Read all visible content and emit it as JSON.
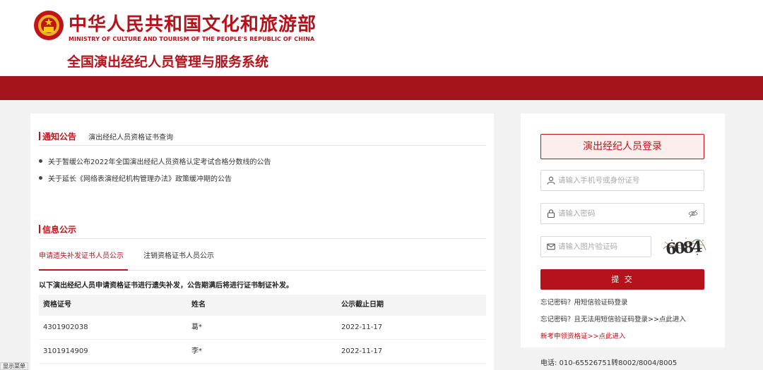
{
  "header": {
    "org_cn": "中华人民共和国文化和旅游部",
    "org_en": "MINISTRY OF CULTURE AND TOURISM OF THE PEOPLE'S REPUBLIC OF CHINA",
    "system_title": "全国演出经纪人员管理与服务系统",
    "emblem_icon": "national-emblem-icon",
    "brand_color": "#b5121b",
    "bar_color": "#a3141c"
  },
  "notice": {
    "section_title": "通知公告",
    "subtitle": "演出经纪人员资格证书查询",
    "items": [
      "关于暂缓公布2022年全国演出经纪人员资格认定考试合格分数线的公告",
      "关于延长《网络表演经纪机构管理办法》政策缓冲期的公告"
    ]
  },
  "info": {
    "section_title": "信息公示",
    "tabs": [
      {
        "label": "申请遗失补发证书人员公示",
        "active": true
      },
      {
        "label": "注销资格证书人员公示",
        "active": false
      }
    ],
    "intro": "以下演出经纪人员申请资格证书进行遗失补发，公告期满后将进行证书制证补发。",
    "columns": [
      "资格证号",
      "姓名",
      "公示截止日期"
    ],
    "rows": [
      [
        "4301902038",
        "葛*",
        "2022-11-17"
      ],
      [
        "3101914909",
        "李*",
        "2022-11-17"
      ]
    ]
  },
  "login": {
    "title": "演出经纪人员登录",
    "username_placeholder": "请输入手机号或身份证号",
    "password_placeholder": "请输入密码",
    "captcha_placeholder": "请输入图片验证码",
    "captcha_text": "6084",
    "submit_label": "提 交",
    "forgot_sms": "忘记密码？用短信验证码登录",
    "forgot_no_sms": "忘记密码？且无法用短信验证码登录>>点此进入",
    "new_cert": "新考申领资格证>>点此进入",
    "icons": [
      "user-icon",
      "lock-icon",
      "eye-off-icon",
      "mail-icon"
    ]
  },
  "footer": {
    "phone": "电话: 010-65526751转8002/8004/8005",
    "show_menu": "显示菜单"
  }
}
